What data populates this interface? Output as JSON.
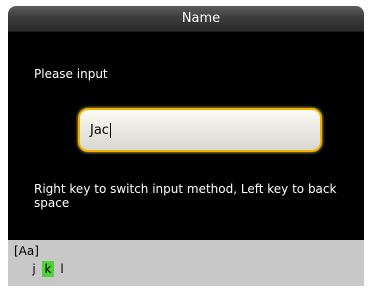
{
  "title": "Name",
  "prompt": "Please input",
  "input": {
    "value": "Jac"
  },
  "hint": "Right key to switch input method, Left key to back space",
  "ime": {
    "mode": "[Aa]",
    "keys": [
      "j",
      "k",
      "l"
    ],
    "selected_key": "k",
    "selected_color": "#4fd13a"
  },
  "colors": {
    "background": "#000000",
    "input_border": "#f0b400",
    "ime_bar": "#c8c8c8"
  }
}
